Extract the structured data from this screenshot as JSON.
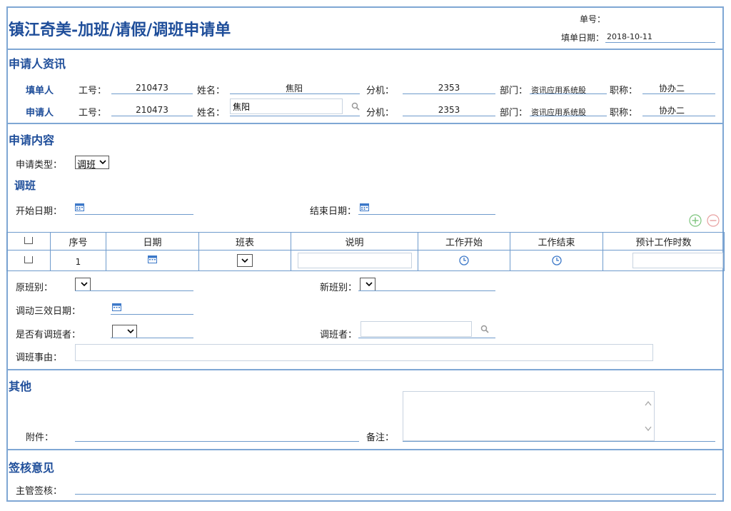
{
  "header": {
    "title": "镇江奇美-加班/请假/调班申请单",
    "form_no_label": "单号：",
    "fill_date_label": "填单日期：",
    "fill_date": "2018-10-11"
  },
  "applicant_section": {
    "title": "申请人资讯",
    "filler": {
      "role_label": "填单人",
      "emp_no_label": "工号：",
      "emp_no": "210473",
      "name_label": "姓名：",
      "name": "焦阳",
      "ext_label": "分机：",
      "ext": "2353",
      "dept_label": "部门：",
      "dept": "资讯应用系统股",
      "title_label": "职称：",
      "job_title": "协办二"
    },
    "applicant": {
      "role_label": "申请人",
      "emp_no_label": "工号：",
      "emp_no": "210473",
      "name_label": "姓名：",
      "name": "焦阳",
      "ext_label": "分机：",
      "ext": "2353",
      "dept_label": "部门：",
      "dept": "资讯应用系统股",
      "title_label": "职称：",
      "job_title": "协办二"
    }
  },
  "content_section": {
    "title": "申请内容",
    "type_label": "申请类型：",
    "type_value": "调班",
    "subsection_title": "调班",
    "start_date_label": "开始日期：",
    "end_date_label": "结束日期："
  },
  "table": {
    "headers": [
      "序号",
      "日期",
      "班表",
      "说明",
      "工作开始",
      "工作结束",
      "预计工作时数"
    ],
    "rows": [
      {
        "seq": "1"
      }
    ]
  },
  "shift_fields": {
    "orig_shift_label": "原班别：",
    "new_shift_label": "新班别：",
    "effective_date_label": "调动三效日期：",
    "has_swapper_label": "是否有调班者：",
    "swapper_label": "调班者：",
    "reason_label": "调班事由："
  },
  "other_section": {
    "title": "其他",
    "attachment_label": "附件：",
    "remark_label": "备注："
  },
  "approval_section": {
    "title": "签核意见",
    "supervisor_label": "主管签核："
  },
  "colors": {
    "accent": "#1f4e9a",
    "border": "#7fa7d4",
    "add": "#3aa63a",
    "remove": "#e07070"
  }
}
